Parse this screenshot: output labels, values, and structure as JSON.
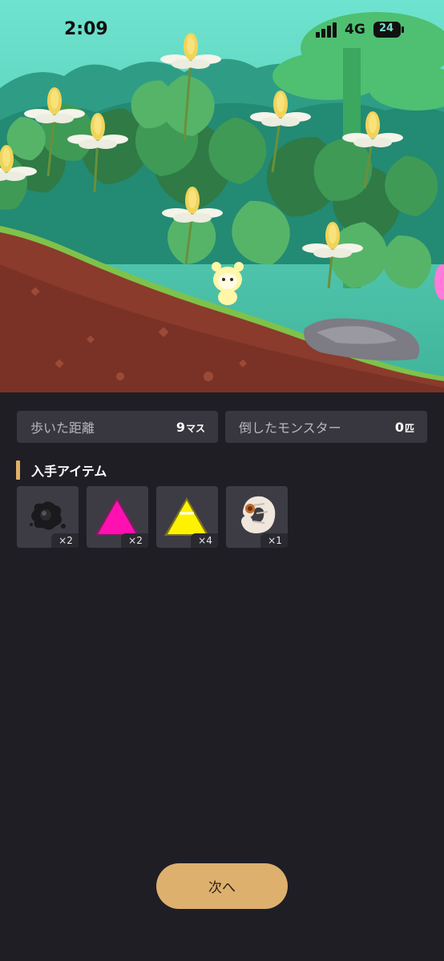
{
  "status_bar": {
    "time": "2:09",
    "network": "4G",
    "battery": "24"
  },
  "stats": {
    "distance": {
      "label": "歩いた距離",
      "value": "9",
      "unit": "マス"
    },
    "monsters": {
      "label": "倒したモンスター",
      "value": "0",
      "unit": "匹"
    }
  },
  "items_section": {
    "title": "入手アイテム"
  },
  "items": [
    {
      "icon": "black-ink-blob-icon",
      "count": "×2"
    },
    {
      "icon": "magenta-triangle-icon",
      "count": "×2"
    },
    {
      "icon": "yellow-triangle-icon",
      "count": "×4"
    },
    {
      "icon": "grub-icon",
      "count": "×1"
    }
  ],
  "next_button": {
    "label": "次へ"
  },
  "colors": {
    "background": "#1f1e25",
    "card": "#38373f",
    "accent": "#deb06d",
    "sky": "#5ed8c3"
  }
}
